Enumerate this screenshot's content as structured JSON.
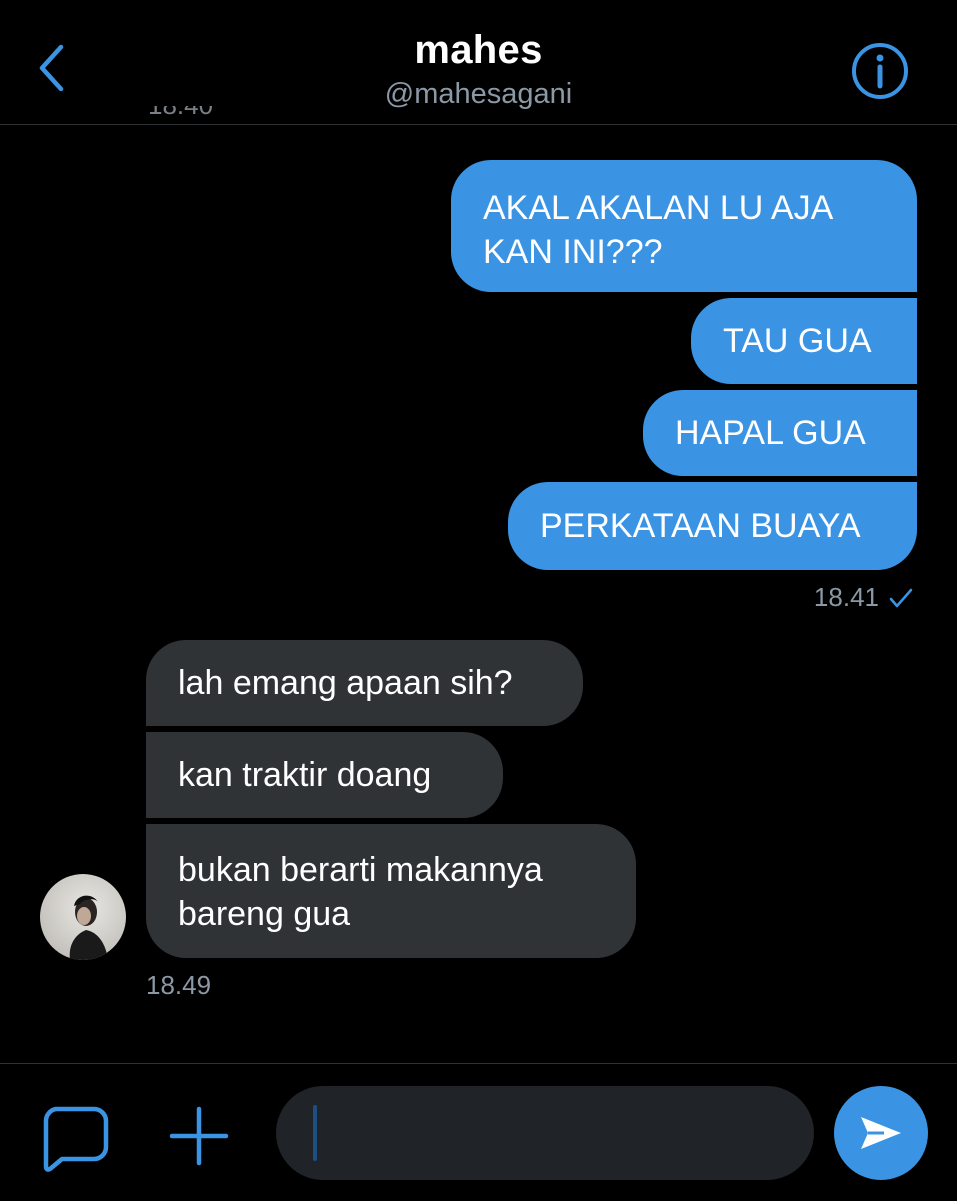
{
  "header": {
    "name": "mahes",
    "handle": "@mahesagani",
    "clipped_timestamp": "18.40"
  },
  "colors": {
    "accent": "#3b94e3",
    "incoming_bubble": "#2f3336",
    "background": "#000000",
    "muted_text": "#8b98a5"
  },
  "icons": {
    "back": "chevron-left-icon",
    "info": "info-icon",
    "new_dm": "message-bubble-icon",
    "add": "plus-icon",
    "send": "send-arrow-icon",
    "read": "checkmark-icon"
  },
  "messages": {
    "outgoing": [
      {
        "line1": "AKAL AKALAN LU AJA",
        "line2": "KAN INI???"
      },
      {
        "text": "TAU GUA"
      },
      {
        "text": "HAPAL GUA"
      },
      {
        "text": "PERKATAAN BUAYA"
      }
    ],
    "outgoing_time": "18.41",
    "incoming": [
      {
        "text": "lah emang apaan sih?"
      },
      {
        "text": "kan traktir doang"
      },
      {
        "line1": "bukan berarti makannya",
        "line2": "bareng gua"
      }
    ],
    "incoming_time": "18.49"
  },
  "composer": {
    "input_value": "",
    "input_placeholder": ""
  }
}
